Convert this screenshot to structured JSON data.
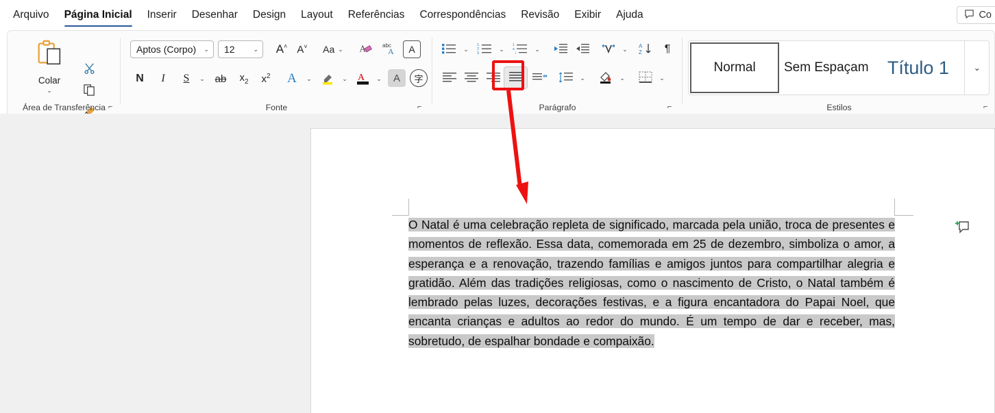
{
  "tabs": [
    {
      "label": "Arquivo",
      "active": false
    },
    {
      "label": "Página Inicial",
      "active": true
    },
    {
      "label": "Inserir",
      "active": false
    },
    {
      "label": "Desenhar",
      "active": false
    },
    {
      "label": "Design",
      "active": false
    },
    {
      "label": "Layout",
      "active": false
    },
    {
      "label": "Referências",
      "active": false
    },
    {
      "label": "Correspondências",
      "active": false
    },
    {
      "label": "Revisão",
      "active": false
    },
    {
      "label": "Exibir",
      "active": false
    },
    {
      "label": "Ajuda",
      "active": false
    }
  ],
  "comment_button": {
    "label": "Co",
    "icon": "comment-icon"
  },
  "ribbon": {
    "groups": [
      {
        "name": "clipboard",
        "label": "Área de Transferência"
      },
      {
        "name": "font",
        "label": "Fonte"
      },
      {
        "name": "paragraph",
        "label": "Parágrafo"
      },
      {
        "name": "styles",
        "label": "Estilos"
      }
    ],
    "clipboard": {
      "paste_label": "Colar",
      "paste_icon": "clipboard-icon",
      "cut_icon": "scissors-icon",
      "copy_icon": "copy-icon",
      "format_painter_icon": "format-painter-icon"
    },
    "font": {
      "font_family_value": "Aptos (Corpo)",
      "font_size_value": "12",
      "grow_font": "A",
      "shrink_font": "A",
      "change_case": "Aa",
      "clear_formatting_icon": "clear-formatting-icon",
      "phonetic_guide": "abc",
      "character_border": "A",
      "bold": "N",
      "italic": "I",
      "underline": "S",
      "strikethrough": "ab",
      "subscript": "x",
      "superscript": "x",
      "text_effects": "A",
      "highlight_icon": "highlighter-icon",
      "font_color": "A",
      "text_highlight": "A",
      "character_shading": "字"
    },
    "paragraph": {
      "bullets_icon": "bullet-list-icon",
      "numbering_icon": "numbered-list-icon",
      "multilevel_icon": "multilevel-list-icon",
      "decrease_indent_icon": "decrease-indent-icon",
      "increase_indent_icon": "increase-indent-icon",
      "text_direction_icon": "text-direction-icon",
      "sort_icon": "sort-az-icon",
      "show_marks": "¶",
      "align_left_icon": "align-left-icon",
      "align_center_icon": "align-center-icon",
      "align_right_icon": "align-right-icon",
      "justify_icon": "justify-icon",
      "justify_active": "true",
      "adjust_icon": "horizontal-spacing-icon",
      "line_spacing_icon": "line-spacing-icon",
      "shading_icon": "shading-icon",
      "borders_icon": "borders-icon"
    },
    "styles": {
      "items": [
        {
          "label": "Normal",
          "selected": true,
          "heading": false
        },
        {
          "label": "Sem Espaçam",
          "selected": false,
          "heading": false
        },
        {
          "label": "Título 1",
          "selected": false,
          "heading": true
        }
      ],
      "more_icon": "chevron-down-icon"
    }
  },
  "document": {
    "paragraph": "O Natal é uma celebração repleta de significado, marcada pela união, troca de presentes e momentos de reflexão. Essa data, comemorada em 25 de dezembro, simboliza o amor, a esperança e a renovação, trazendo famílias e amigos juntos para compartilhar alegria e gratidão. Além das tradições religiosas, como o nascimento de Cristo, o Natal também é lembrado pelas luzes, decorações festivas, e a figura encantadora do Papai Noel, que encanta crianças e adultos ao redor do mundo. É um tempo de dar e receber, mas, sobretudo, de espalhar bondade e compaixão.",
    "selected": true,
    "alignment": "justify",
    "add_comment_icon": "add-comment-icon"
  },
  "annotation": {
    "highlight_color": "#ee1111",
    "target": "justify-button",
    "arrow_from": "justify-button",
    "arrow_to": "document-text"
  }
}
